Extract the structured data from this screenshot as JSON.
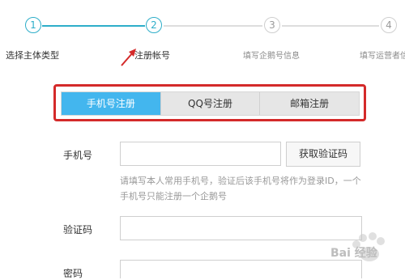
{
  "stepper": {
    "steps": [
      {
        "number": "1",
        "label": "选择主体类型"
      },
      {
        "number": "2",
        "label": "注册帐号"
      },
      {
        "number": "3",
        "label": "填写企鹅号信息"
      },
      {
        "number": "4",
        "label": "填写运营者信"
      }
    ],
    "active_color": "#2eaec9"
  },
  "tabs": {
    "items": [
      "手机号注册",
      "QQ号注册",
      "邮箱注册"
    ],
    "selected": "手机号注册",
    "highlight_color": "#d42a2a",
    "active_bg": "#43b6ee"
  },
  "form": {
    "phone": {
      "label": "手机号",
      "value": "",
      "get_code_label": "获取验证码",
      "hint_line1": "请填写本人常用手机号，验证后该手机号将作为登录ID，一个",
      "hint_line2": "手机号只能注册一个企鹅号"
    },
    "code": {
      "label": "验证码",
      "value": ""
    },
    "password": {
      "label": "密码",
      "value": ""
    }
  },
  "watermark": {
    "text": "Bai 经验"
  }
}
